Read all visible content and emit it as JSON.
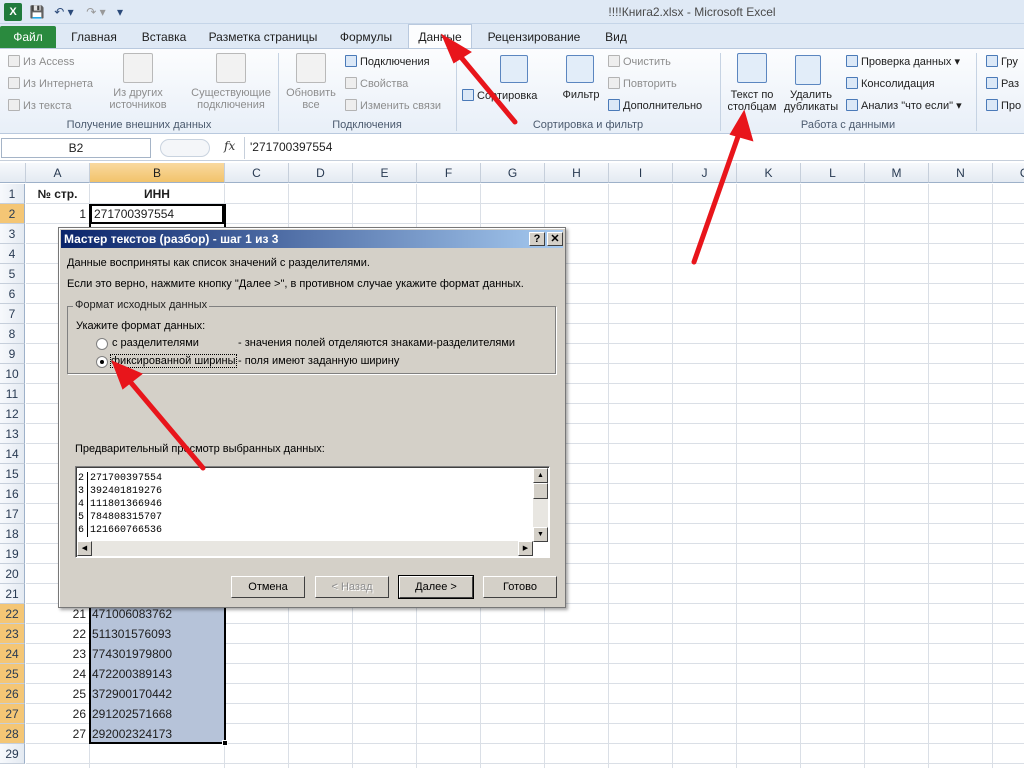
{
  "window": {
    "title": "!!!!Книга2.xlsx  -  Microsoft Excel"
  },
  "quick_access": {
    "logo": "X",
    "save": "💾",
    "undo": "↶ ▾",
    "redo": "↷ ▾",
    "customize": "▾"
  },
  "tabs": [
    {
      "label": "Файл"
    },
    {
      "label": "Главная"
    },
    {
      "label": "Вставка"
    },
    {
      "label": "Разметка страницы"
    },
    {
      "label": "Формулы"
    },
    {
      "label": "Данные"
    },
    {
      "label": "Рецензирование"
    },
    {
      "label": "Вид"
    }
  ],
  "ribbon": {
    "external": {
      "from_access": "Из Access",
      "from_web": "Из Интернета",
      "from_text": "Из текста",
      "from_other_1": "Из других",
      "from_other_2": "источников",
      "existing_1": "Существующие",
      "existing_2": "подключения",
      "label": "Получение внешних данных"
    },
    "connections": {
      "refresh_1": "Обновить",
      "refresh_2": "все",
      "connections": "Подключения",
      "properties": "Свойства",
      "edit_links": "Изменить связи",
      "label": "Подключения"
    },
    "sort_filter": {
      "sort": "Сортировка",
      "filter": "Фильтр",
      "clear": "Очистить",
      "reapply": "Повторить",
      "advanced": "Дополнительно",
      "label": "Сортировка и фильтр"
    },
    "data_tools": {
      "text_to_cols_1": "Текст по",
      "text_to_cols_2": "столбцам",
      "remove_dup_1": "Удалить",
      "remove_dup_2": "дубликаты",
      "validation": "Проверка данных",
      "consolidate": "Консолидация",
      "what_if": "Анализ \"что если\"",
      "label": "Работа с данными"
    },
    "outline": {
      "group": "Гру",
      "ungroup": "Раз",
      "subtotal": "Про"
    }
  },
  "formula_bar": {
    "name_box": "B2",
    "fx": "fx",
    "value": "'271700397554"
  },
  "columns": [
    "A",
    "B",
    "C",
    "D",
    "E",
    "F",
    "G",
    "H",
    "I",
    "J",
    "K",
    "L",
    "M",
    "N",
    "O"
  ],
  "headers": {
    "a": "№ стр.",
    "b": "ИНН"
  },
  "rows": [
    {
      "r": "1"
    },
    {
      "r": "2",
      "a": "1",
      "b": "271700397554"
    },
    {
      "r": "3"
    },
    {
      "r": "4"
    },
    {
      "r": "5"
    },
    {
      "r": "6"
    },
    {
      "r": "7"
    },
    {
      "r": "8"
    },
    {
      "r": "9"
    },
    {
      "r": "10"
    },
    {
      "r": "11"
    },
    {
      "r": "12"
    },
    {
      "r": "13"
    },
    {
      "r": "14"
    },
    {
      "r": "15"
    },
    {
      "r": "16"
    },
    {
      "r": "17"
    },
    {
      "r": "18"
    },
    {
      "r": "19"
    },
    {
      "r": "20"
    },
    {
      "r": "21"
    },
    {
      "r": "22",
      "a": "21",
      "b": "471006083762"
    },
    {
      "r": "23",
      "a": "22",
      "b": "511301576093"
    },
    {
      "r": "24",
      "a": "23",
      "b": "774301979800"
    },
    {
      "r": "25",
      "a": "24",
      "b": "472200389143"
    },
    {
      "r": "26",
      "a": "25",
      "b": "372900170442"
    },
    {
      "r": "27",
      "a": "26",
      "b": "291202571668"
    },
    {
      "r": "28",
      "a": "27",
      "b": "292002324173"
    },
    {
      "r": "29"
    }
  ],
  "dialog": {
    "title": "Мастер текстов (разбор) - шаг 1 из 3",
    "help": "?",
    "close": "✕",
    "line1": "Данные восприняты как список значений с разделителями.",
    "line2": "Если это верно, нажмите кнопку \"Далее >\", в противном случае укажите формат данных.",
    "group_label": "Формат исходных данных",
    "prompt": "Укажите формат данных:",
    "opt1": "с разделителями",
    "opt1_desc": "- значения полей отделяются знаками-разделителями",
    "opt2": "фиксированной ширины",
    "opt2_desc": "- поля имеют заданную ширину",
    "selected": "fixed",
    "preview_label": "Предварительный просмотр выбранных данных:",
    "preview": [
      {
        "n": "2",
        "v": "271700397554"
      },
      {
        "n": "3",
        "v": "392401819276"
      },
      {
        "n": "4",
        "v": "111801366946"
      },
      {
        "n": "5",
        "v": "784808315707"
      },
      {
        "n": "6",
        "v": "121660766536"
      }
    ],
    "buttons": {
      "cancel": "Отмена",
      "back": "< Назад",
      "next": "Далее >",
      "finish": "Готово"
    }
  },
  "colors": {
    "arrow": "#e8151b",
    "selection": "#b6c3d9",
    "file_tab": "#2a8a3e",
    "dialog_title": "#0a246a"
  }
}
